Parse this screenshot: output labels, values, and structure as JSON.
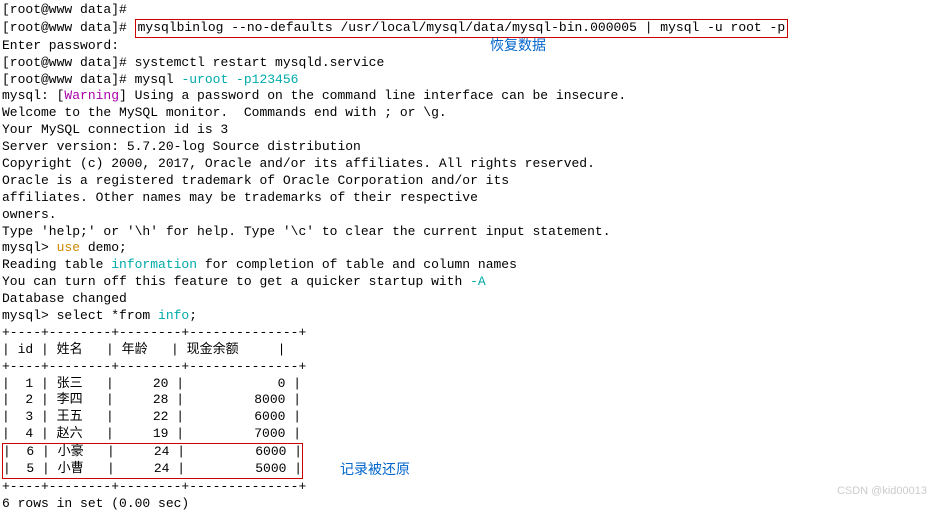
{
  "lines": {
    "l0": "[root@www data]# ",
    "l1_prompt": "[root@www data]# ",
    "l1_cmd": "mysqlbinlog --no-defaults /usr/local/mysql/data/mysql-bin.000005 | mysql -u root -p",
    "l2": "Enter password:",
    "l3_prompt": "[root@www data]# ",
    "l3_cmd": "systemctl restart mysqld.service",
    "l4_prompt": "[root@www data]# ",
    "l4_cmd_a": "mysql ",
    "l4_cmd_b": "-uroot -p123456",
    "l5_a": "mysql: [",
    "l5_b": "Warning",
    "l5_c": "] Using a password on the command line interface can be insecure.",
    "l6": "Welcome to the MySQL monitor.  Commands end with ; or \\g.",
    "l7": "Your MySQL connection id is 3",
    "l8": "Server version: 5.7.20-log Source distribution",
    "l9": "",
    "l10": "Copyright (c) 2000, 2017, Oracle and/or its affiliates. All rights reserved.",
    "l11": "",
    "l12": "Oracle is a registered trademark of Oracle Corporation and/or its",
    "l13": "affiliates. Other names may be trademarks of their respective",
    "l14": "owners.",
    "l15": "",
    "l16": "Type 'help;' or '\\h' for help. Type '\\c' to clear the current input statement.",
    "l17": "",
    "l18_a": "mysql> ",
    "l18_b": "use",
    "l18_c": " demo;",
    "l19_a": "Reading table ",
    "l19_b": "information",
    "l19_c": " for completion of table and column names",
    "l20_a": "You can turn off this feature to get a quicker startup with ",
    "l20_b": "-A",
    "l21": "",
    "l22": "Database changed",
    "l23_a": "mysql> select *from ",
    "l23_b": "info",
    "l23_c": ";",
    "sep": "+----+--------+--------+--------------+",
    "hdr": "| id | 姓名   | 年龄   | 现金余额     |",
    "r1": "|  1 | 张三   |     20 |            0 |",
    "r2": "|  2 | 李四   |     28 |         8000 |",
    "r3": "|  3 | 王五   |     22 |         6000 |",
    "r4": "|  4 | 赵六   |     19 |         7000 |",
    "r5": "|  6 | 小豪   |     24 |         6000 |",
    "r6": "|  5 | 小曹   |     24 |         5000 |",
    "footer": "6 rows in set (0.00 sec)"
  },
  "annotations": {
    "a1": "恢复数据",
    "a2": "记录被还原"
  },
  "watermark": "CSDN @kid00013",
  "chart_data": {
    "type": "table",
    "columns": [
      "id",
      "姓名",
      "年龄",
      "现金余额"
    ],
    "rows": [
      {
        "id": 1,
        "姓名": "张三",
        "年龄": 20,
        "现金余额": 0
      },
      {
        "id": 2,
        "姓名": "李四",
        "年龄": 28,
        "现金余额": 8000
      },
      {
        "id": 3,
        "姓名": "王五",
        "年龄": 22,
        "现金余额": 6000
      },
      {
        "id": 4,
        "姓名": "赵六",
        "年龄": 19,
        "现金余额": 7000
      },
      {
        "id": 6,
        "姓名": "小豪",
        "年龄": 24,
        "现金余额": 6000
      },
      {
        "id": 5,
        "姓名": "小曹",
        "年龄": 24,
        "现金余额": 5000
      }
    ]
  }
}
